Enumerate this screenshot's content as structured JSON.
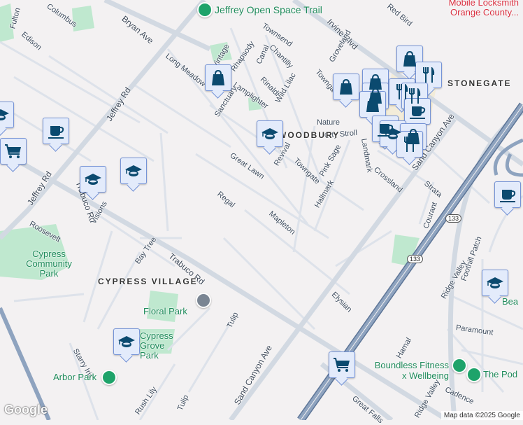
{
  "streets": [
    "Fulton",
    "Edison",
    "Columbus",
    "Bryan Ave",
    "Jeffrey Rd",
    "Jeffrey Rd",
    "Long Meadow",
    "Vintage",
    "Rhapsody",
    "Canal",
    "Lamplighter",
    "Rinaldi",
    "Wild Lilac",
    "Sanctuary",
    "Great Lawn",
    "Regal",
    "Townsend",
    "Chantilly",
    "Irvine Blvd",
    "Groveland",
    "Towngate",
    "Nature",
    "City Stroll",
    "Revival",
    "Towngate",
    "Pink Sage",
    "Landmark",
    "Crossland",
    "Sand Canyon Ave",
    "Strata",
    "Hallmark",
    "Mapleton",
    "Courant",
    "Trabuco Rd",
    "Trabuco Rd",
    "Visions",
    "Roosevelt",
    "Bay Tree",
    "Tulip",
    "Tulip",
    "Starry Iris",
    "Rush Lily",
    "Sand Canyon Ave",
    "Elysian",
    "Ridge Valley",
    "Ridge Valley",
    "Paramount",
    "Hamal",
    "Cadence",
    "Great Falls",
    "Foothill Patch",
    "Red Bird"
  ],
  "districts": [
    "CYPRESS VILLAGE",
    "WOODBURY",
    "STONEGATE"
  ],
  "pois": {
    "jeffrey_trail": "Jeffrey Open Space Trail",
    "locksmith": "Mobile Locksmith Orange County...",
    "cypress_community_park": "Cypress Community Park",
    "floral_park": "Floral Park",
    "cypress_grove_park": "Cypress Grove Park",
    "arbor_park": "Arbor Park",
    "boundless_fitness": "Boundless Fitness x Wellbeing",
    "the_pod": "The Pod",
    "beacon": "Bea"
  },
  "highway_shield": "133",
  "markers": [
    "shopping",
    "school",
    "coffee",
    "school",
    "grocery",
    "school",
    "school",
    "school",
    "grocery",
    "coffee",
    "school",
    "shopping",
    "restaurant",
    "shopping",
    "shopping",
    "shopping",
    "shopping",
    "restaurant",
    "restaurant",
    "coffee",
    "coffee",
    "school",
    "shopping",
    "restaurant"
  ],
  "footer": {
    "logo": "Google",
    "attribution": "Map data ©2025 Google"
  },
  "colors": {
    "marker_fill": "#e3ebfb",
    "marker_icon": "#0b4a6f",
    "park": "#bfe8cf",
    "freeway": "#8097b3"
  }
}
